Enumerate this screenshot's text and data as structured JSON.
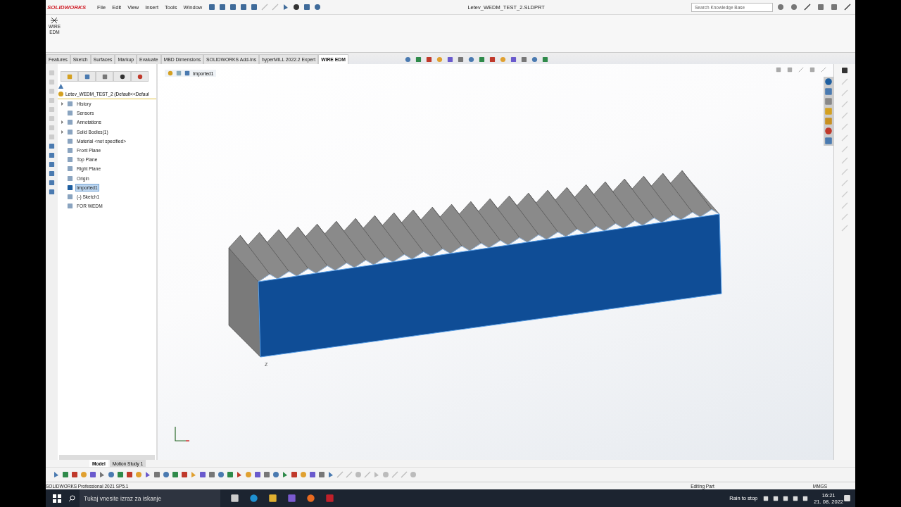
{
  "app": {
    "logo": "SOLIDWORKS",
    "menu": [
      "File",
      "Edit",
      "View",
      "Insert",
      "Tools",
      "Window"
    ],
    "title": "Letev_WEDM_TEST_2.SLDPRT",
    "search": {
      "placeholder": "Search Knowledge Base"
    }
  },
  "ribbon": {
    "command": {
      "label_line1": "WIRE",
      "label_line2": "EDM"
    }
  },
  "command_tabs": [
    {
      "label": "Features",
      "selected": false
    },
    {
      "label": "Sketch",
      "selected": false
    },
    {
      "label": "Surfaces",
      "selected": false
    },
    {
      "label": "Markup",
      "selected": false
    },
    {
      "label": "Evaluate",
      "selected": false
    },
    {
      "label": "MBD Dimensions",
      "selected": false
    },
    {
      "label": "SOLIDWORKS Add-Ins",
      "selected": false
    },
    {
      "label": "hyperMILL 2022.2 Expert",
      "selected": false
    },
    {
      "label": "WIRE EDM",
      "selected": true
    }
  ],
  "feature_tree": {
    "root": "Letev_WEDM_TEST_2  (Default<<Defaul",
    "items": [
      {
        "label": "History",
        "kind": "group",
        "selected": false
      },
      {
        "label": "Sensors",
        "kind": "item",
        "selected": false
      },
      {
        "label": "Annotations",
        "kind": "group",
        "selected": false
      },
      {
        "label": "Solid Bodies(1)",
        "kind": "group",
        "selected": false
      },
      {
        "label": "Material <not specified>",
        "kind": "item",
        "selected": false
      },
      {
        "label": "Front Plane",
        "kind": "item",
        "selected": false
      },
      {
        "label": "Top Plane",
        "kind": "item",
        "selected": false
      },
      {
        "label": "Right Plane",
        "kind": "item",
        "selected": false
      },
      {
        "label": "Origin",
        "kind": "item",
        "selected": false
      },
      {
        "label": "Imported1",
        "kind": "item",
        "selected": true
      },
      {
        "label": "(-) Sketch1",
        "kind": "item",
        "selected": false
      },
      {
        "label": "FOR WEDM",
        "kind": "item",
        "selected": false
      }
    ]
  },
  "breadcrumb": {
    "label": "Imported1"
  },
  "viewport": {
    "axis_label": "Z"
  },
  "bottom_tabs": [
    {
      "label": "Model",
      "selected": true
    },
    {
      "label": "Motion Study 1",
      "selected": false
    }
  ],
  "status_bar": {
    "product": "SOLIDWORKS Professional 2021 SP5.1",
    "mode": "Editing Part",
    "units": "MMGS"
  },
  "taskbar": {
    "search": {
      "placeholder": "Tukaj vnesite izraz za iskanje"
    },
    "weather": "Rain to stop",
    "time": "16:21",
    "date": "21. 08. 2022"
  }
}
